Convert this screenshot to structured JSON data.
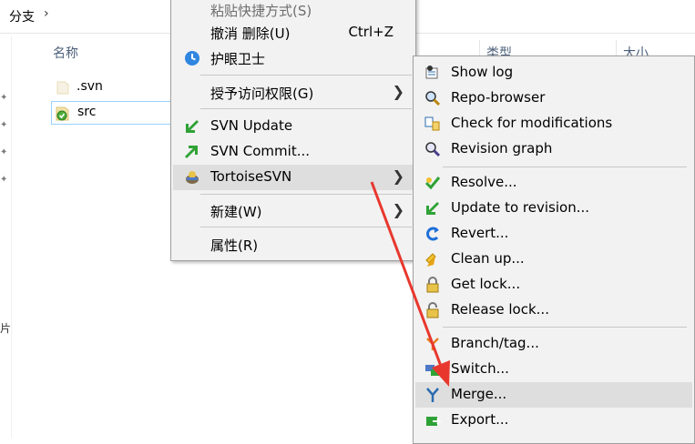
{
  "explorer": {
    "breadcrumb": "分支",
    "columns": {
      "name": "名称",
      "type": "类型",
      "size": "大小"
    },
    "files": [
      {
        "name": ".svn"
      },
      {
        "name": "src"
      }
    ],
    "side_letter": "片"
  },
  "main_menu": {
    "items": [
      {
        "label": "粘贴快捷方式(S)"
      },
      {
        "label": "撤消 删除(U)",
        "shortcut": "Ctrl+Z"
      },
      {
        "label": "护眼卫士"
      },
      {
        "label": "授予访问权限(G)"
      },
      {
        "label": "SVN Update"
      },
      {
        "label": "SVN Commit..."
      },
      {
        "label": "TortoiseSVN"
      },
      {
        "label": "新建(W)"
      },
      {
        "label": "属性(R)"
      }
    ]
  },
  "svn_menu": {
    "items": [
      {
        "label": "Show log"
      },
      {
        "label": "Repo-browser"
      },
      {
        "label": "Check for modifications"
      },
      {
        "label": "Revision graph"
      },
      {
        "label": "Resolve..."
      },
      {
        "label": "Update to revision..."
      },
      {
        "label": "Revert..."
      },
      {
        "label": "Clean up..."
      },
      {
        "label": "Get lock..."
      },
      {
        "label": "Release lock..."
      },
      {
        "label": "Branch/tag..."
      },
      {
        "label": "Switch..."
      },
      {
        "label": "Merge..."
      },
      {
        "label": "Export..."
      }
    ]
  },
  "colors": {
    "menu_bg": "#f2f2f2",
    "highlight": "#dedede",
    "annotation_arrow": "#e8382e"
  }
}
